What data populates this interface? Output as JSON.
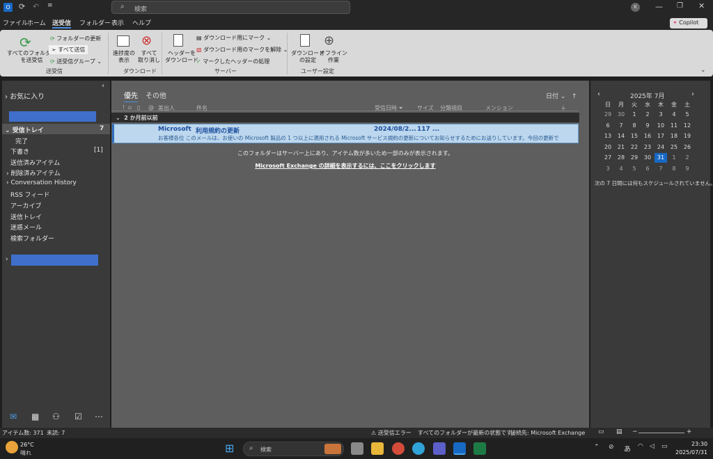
{
  "title_search_placeholder": "検索",
  "avatar_initial": "K",
  "copilot_label": "Copilot",
  "menu": [
    "ファイル",
    "ホーム",
    "送受信",
    "フォルダー",
    "表示",
    "ヘルプ"
  ],
  "ribbon": {
    "send_all_folders": "すべてのフォルダー\nを送受信",
    "update_folder": "フォルダーの更新",
    "send_all": "すべて送信",
    "send_receive_groups": "送受信グループ",
    "group_send_receive": "送受信",
    "show_progress": "進捗度の\n表示",
    "cancel_all": "すべて\n取り消し",
    "group_download": "ダウンロード",
    "download_headers": "ヘッダーを\nダウンロード",
    "mark_download": "ダウンロード用にマーク",
    "unmark_download": "ダウンロード用のマークを解除",
    "process_marked": "マークしたヘッダーの処理",
    "group_server": "サーバー",
    "download_settings": "ダウンロード\nの設定",
    "offline": "オフライン\n作業",
    "group_user": "ユーザー設定"
  },
  "folders": {
    "favorites": "お気に入り",
    "inbox": "受信トレイ",
    "inbox_count": "7",
    "done": "完了",
    "drafts": "下書き",
    "drafts_count": "[1]",
    "sent": "送信済みアイテム",
    "deleted": "削除済みアイテム",
    "conversation": "Conversation History",
    "rss": "RSS フィード",
    "archive": "アーカイブ",
    "outbox": "送信トレイ",
    "junk": "迷惑メール",
    "search": "検索フォルダー"
  },
  "list": {
    "tab_focused": "優先",
    "tab_other": "その他",
    "sort": "日付",
    "col_from": "差出人",
    "col_subject": "件名",
    "col_received": "受信日時",
    "col_size": "サイズ",
    "col_category": "分類項目",
    "col_mention": "メンション",
    "group_header": "2 か月前以前",
    "email_from": "Microsoft",
    "email_subject": "利用規約の更新",
    "email_date": "2024/08/2...",
    "email_size": "117 ...",
    "email_preview": "お客様各位 このメールは、お使いの Microsoft 製品の 1 つ以上に適用される Microsoft サービス規約の更新についてお知らせするためにお送りしています。今回の更新で",
    "server_notice": "このフォルダーはサーバー上にあり、アイテム数が多いため一部のみが表示されます。",
    "exchange_link": "Microsoft Exchange の詳細を表示するには、ここをクリックします"
  },
  "calendar": {
    "month": "2025年 7月",
    "weekdays": [
      "日",
      "月",
      "火",
      "水",
      "木",
      "金",
      "土"
    ],
    "rows": [
      [
        "29",
        "30",
        "1",
        "2",
        "3",
        "4",
        "5"
      ],
      [
        "6",
        "7",
        "8",
        "9",
        "10",
        "11",
        "12"
      ],
      [
        "13",
        "14",
        "15",
        "16",
        "17",
        "18",
        "19"
      ],
      [
        "20",
        "21",
        "22",
        "23",
        "24",
        "25",
        "26"
      ],
      [
        "27",
        "28",
        "29",
        "30",
        "31",
        "1",
        "2"
      ],
      [
        "3",
        "4",
        "5",
        "6",
        "7",
        "8",
        "9"
      ]
    ],
    "today": "31",
    "no_schedule": "次の 7 日間には何もスケジュールされていません。"
  },
  "status": {
    "item_count": "アイテム数: 371",
    "unread": "未読: 7",
    "send_error": "送受信エラー",
    "all_updated": "すべてのフォルダーが最新の状態です。",
    "connected": "接続先: Microsoft Exchange"
  },
  "taskbar": {
    "temp": "26°C",
    "weather": "晴れ",
    "search": "検索",
    "ime": "あ",
    "time": "23:30",
    "date": "2025/07/31"
  },
  "colors": {
    "accent": "#2f6fbf",
    "selected_row": "#bcd7ee",
    "redacted": "#3f6fcb"
  }
}
